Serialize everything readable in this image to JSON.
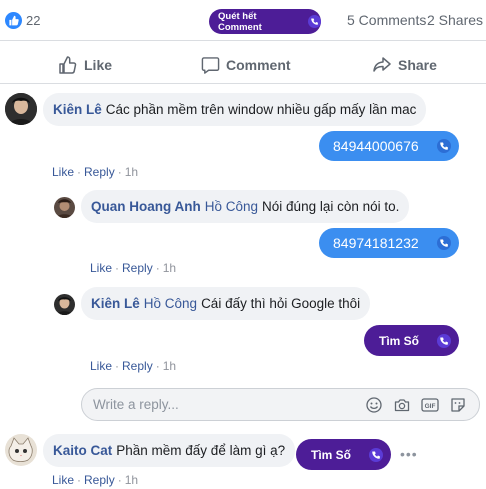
{
  "post_stats": {
    "like_count": "22",
    "scan_button_label": "Quét hết Comment",
    "comments": "5 Comments",
    "shares": "2 Shares"
  },
  "actions": {
    "like": "Like",
    "comment": "Comment",
    "share": "Share"
  },
  "comments": [
    {
      "author": "Kiên Lê",
      "mention": "",
      "text": "Các phần mềm trên window nhiều gấp mấy lần mac",
      "phone": "84944000676",
      "meta": {
        "like": "Like",
        "reply": "Reply",
        "time": "1h"
      }
    },
    {
      "author": "Quan Hoang Anh",
      "mention": "Hồ Công",
      "text": "Nói đúng lại còn nói to.",
      "phone": "84974181232",
      "meta": {
        "like": "Like",
        "reply": "Reply",
        "time": "1h"
      }
    },
    {
      "author": "Kiên Lê",
      "mention": "Hồ Công",
      "text": "Cái đấy thì hỏi Google thôi",
      "find_label": "Tìm Số",
      "meta": {
        "like": "Like",
        "reply": "Reply",
        "time": "1h"
      }
    },
    {
      "author": "Kaito Cat",
      "mention": "",
      "text": "Phần mềm đấy để làm gì ạ?",
      "find_label": "Tìm Số",
      "meta": {
        "like": "Like",
        "reply": "Reply",
        "time": "1h"
      }
    }
  ],
  "reply_box": {
    "placeholder": "Write a reply..."
  },
  "colors": {
    "brand_blue": "#385898",
    "phone_pill": "#3b8ef0",
    "scan_pill": "#4d1d97"
  },
  "icons": [
    "like-icon",
    "comment-icon",
    "share-icon",
    "phone-icon",
    "emoji-icon",
    "camera-icon",
    "gif-icon",
    "sticker-icon",
    "more-icon"
  ]
}
